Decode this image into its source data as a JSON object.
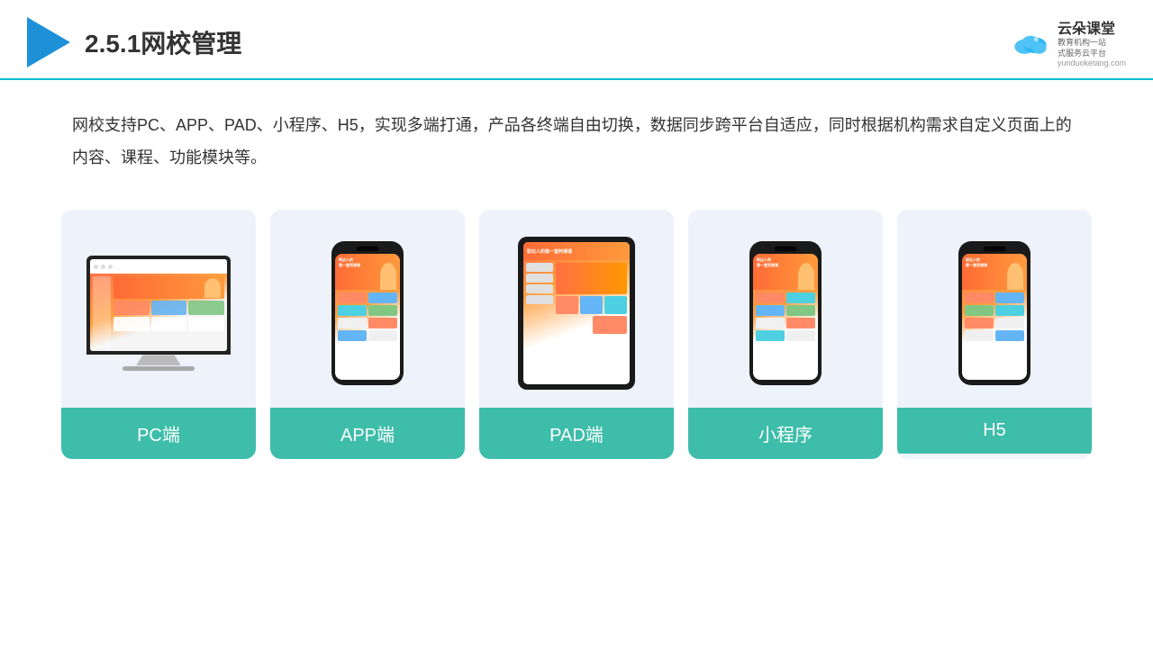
{
  "header": {
    "title": "2.5.1网校管理",
    "brand": {
      "name_cn": "云朵课堂",
      "tagline_line1": "教育机构一站",
      "tagline_line2": "式服务云平台",
      "url": "yunduoketang.com"
    }
  },
  "description": {
    "text": "网校支持PC、APP、PAD、小程序、H5，实现多端打通，产品各终端自由切换，数据同步跨平台自适应，同时根据机构需求自定义页面上的内容、课程、功能模块等。"
  },
  "cards": [
    {
      "label": "PC端",
      "type": "pc"
    },
    {
      "label": "APP端",
      "type": "phone"
    },
    {
      "label": "PAD端",
      "type": "pad"
    },
    {
      "label": "小程序",
      "type": "phone2"
    },
    {
      "label": "H5",
      "type": "phone3"
    }
  ]
}
